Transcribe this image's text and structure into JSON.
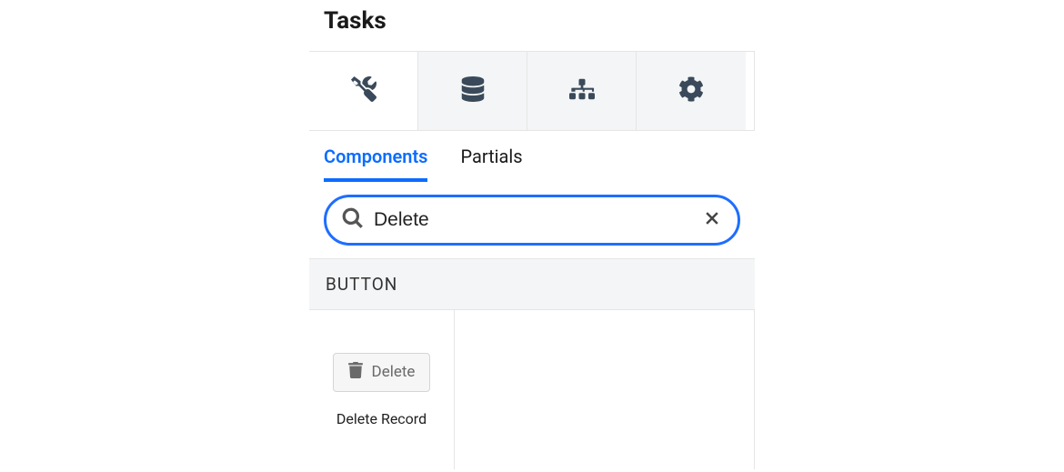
{
  "header": {
    "title": "Tasks"
  },
  "topTabs": {
    "items": [
      {
        "name": "tools-icon"
      },
      {
        "name": "database-icon"
      },
      {
        "name": "sitemap-icon"
      },
      {
        "name": "gear-icon"
      }
    ]
  },
  "subTabs": {
    "items": [
      {
        "label": "Components",
        "active": true
      },
      {
        "label": "Partials",
        "active": false
      }
    ]
  },
  "search": {
    "value": "Delete",
    "placeholder": ""
  },
  "category": {
    "label": "BUTTON"
  },
  "results": {
    "items": [
      {
        "previewButtonLabel": "Delete",
        "label": "Delete Record"
      }
    ]
  }
}
